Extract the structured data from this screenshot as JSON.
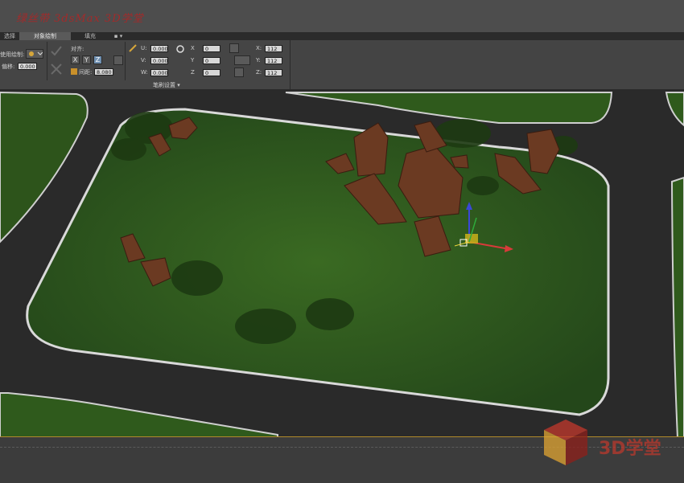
{
  "watermark_top": "绿丝带 3dsMax 3D学堂",
  "tabs": [
    {
      "label": "选择",
      "active": false
    },
    {
      "label": "对象绘制",
      "active": true
    },
    {
      "label": "填充",
      "active": false
    },
    {
      "label": "▪ ▾",
      "active": false
    }
  ],
  "ribbon": {
    "paint_on_label": "使用绘制:",
    "offset_label": "偏移:",
    "offset_value": "0.000",
    "align_label": "对齐:",
    "axis_x": "X",
    "axis_y": "Y",
    "axis_z": "Z",
    "spacing_label": "间距:",
    "spacing_value": "8.080",
    "u_label": "U:",
    "u_value": "0.000",
    "v_label": "V:",
    "v_value": "0.000",
    "w_label": "W:",
    "w_value": "0.000",
    "rot_x_label": "X",
    "rot_x_value": "0",
    "rot_y_label": "Y",
    "rot_y_value": "0",
    "rot_z_label": "Z",
    "rot_z_value": "0",
    "scale_x_label": "X:",
    "scale_x_value": "112",
    "scale_y_label": "Y:",
    "scale_y_value": "112",
    "scale_z_label": "Z:",
    "scale_z_value": "112",
    "brush_settings_label": "笔刷设置 ▾"
  },
  "logo_watermark": "3D学堂",
  "colors": {
    "grass": "#2f5a1c",
    "road": "#2a2a2a",
    "curb": "#d9d9d9",
    "rock": "#6b3a22",
    "accent_active_tab": "#5a5a5a"
  }
}
